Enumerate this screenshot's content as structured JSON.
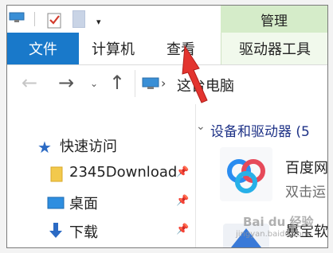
{
  "qat": {
    "dropdown_glyph": "▾",
    "manage_label": "管理"
  },
  "tabs": {
    "file": "文件",
    "computer": "计算机",
    "view": "查看",
    "drive_tools": "驱动器工具"
  },
  "nav": {
    "back": "←",
    "forward": "→",
    "recent": "⌄",
    "up": "↑",
    "chevron": "›",
    "path": "这台电脑"
  },
  "sidebar": {
    "quick_access": "快速访问",
    "items": [
      {
        "label": "2345Download",
        "icon": "folder-icon"
      },
      {
        "label": "桌面",
        "icon": "desktop-icon"
      },
      {
        "label": "下载",
        "icon": "download-arrow-icon"
      }
    ],
    "pin_glyph": "📌"
  },
  "main": {
    "group_chevron": "⌄",
    "group_header": "设备和驱动器 (5",
    "app1_name": "百度网",
    "app1_sub": "双击运",
    "app2_name": "暴宝软"
  },
  "watermark": {
    "text": "Bai du 经验",
    "url": "jingyan.baidu.com"
  },
  "colors": {
    "file_tab": "#1979ca",
    "manage_tab": "#d5ecc9",
    "group_header": "#1e3287",
    "arrow": "#e3342f"
  }
}
